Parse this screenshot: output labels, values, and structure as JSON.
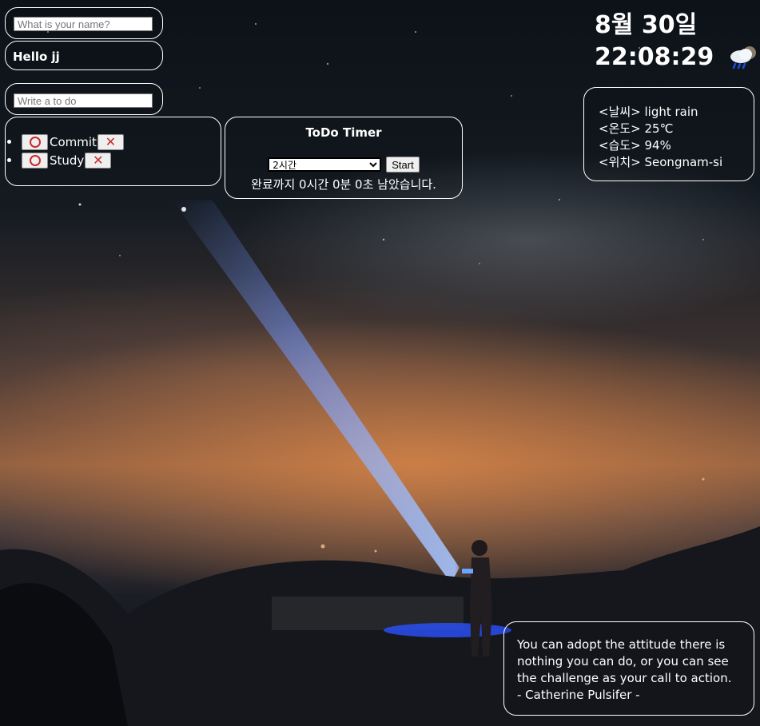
{
  "greeting": {
    "name_placeholder": "What is your name?",
    "hello_text": "Hello jj"
  },
  "todo": {
    "input_placeholder": "Write a to do",
    "items": [
      {
        "label": "Commit"
      },
      {
        "label": "Study"
      }
    ],
    "done_icon": "circle-o-icon",
    "delete_icon": "x-cross-icon"
  },
  "timer": {
    "title": "ToDo Timer",
    "selected_option": "2시간",
    "start_label": "Start",
    "remaining_text": "완료까지 0시간 0분 0초 남았습니다."
  },
  "clock": {
    "date": "8월 30일",
    "time": "22:08:29",
    "weather_icon": "rain-cloud-icon"
  },
  "weather": {
    "condition": "<날씨> light rain",
    "temperature": "<온도> 25℃",
    "humidity": "<습도> 94%",
    "location": "<위치> Seongnam-si"
  },
  "quote": {
    "lines": [
      "You can adopt the attitude there is",
      "nothing you can do, or you can see",
      "the challenge as your call to action.",
      "- Catherine Pulsifer -"
    ]
  },
  "colors": {
    "border": "#ffffff",
    "mark_red": "#c92a2a",
    "beam_blue": "#7aa0ff"
  }
}
